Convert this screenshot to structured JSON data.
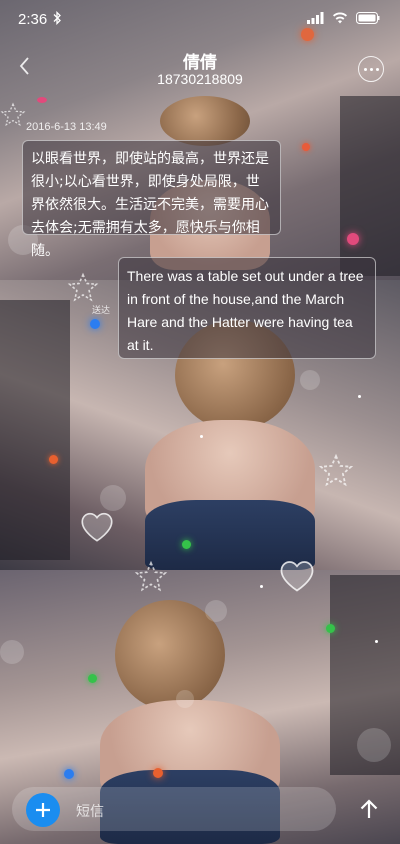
{
  "status": {
    "time": "2:36"
  },
  "header": {
    "title": "倩倩",
    "subtitle": "18730218809"
  },
  "messages": {
    "timestamp": "2016-6-13 13:49",
    "incoming": "以眼看世界，即使站的最高，世界还是很小;以心看世界，即使身处局限，世界依然很大。生活远不完美，需要用心去体会;无需拥有太多，愿快乐与你相随。",
    "outgoing": "There was a table set out under a tree in front of the house,and the March Hare and the Hatter were having tea at it.",
    "outgoing_status": "送达"
  },
  "composer": {
    "placeholder": "短信"
  },
  "colors": {
    "accent": "#1a8df0"
  },
  "icons": [
    "bluetooth-icon",
    "signal-icon",
    "wifi-icon",
    "battery-icon",
    "back-arrow-icon",
    "more-icon",
    "plus-icon",
    "send-arrow-icon"
  ]
}
